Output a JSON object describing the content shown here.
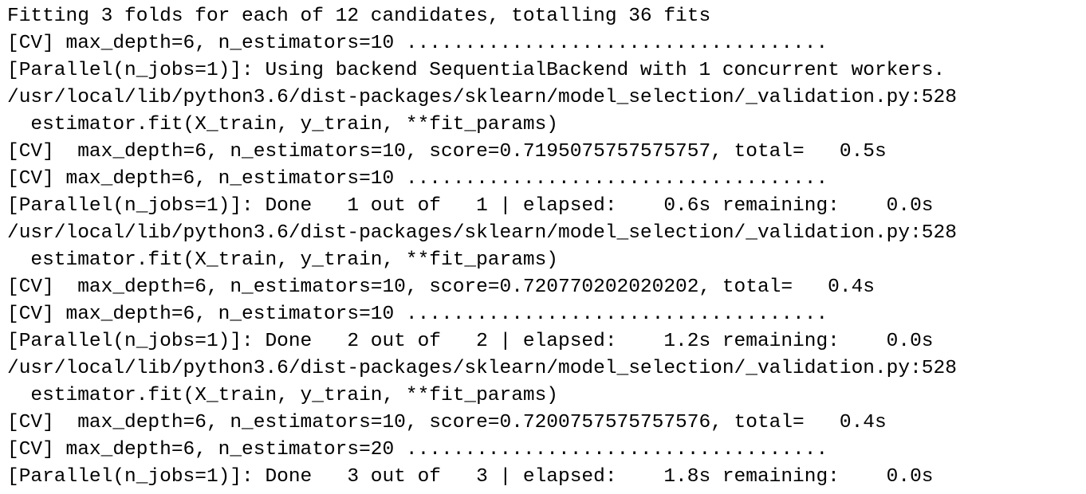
{
  "console": {
    "lines": [
      "Fitting 3 folds for each of 12 candidates, totalling 36 fits",
      "[CV] max_depth=6, n_estimators=10 ....................................",
      "[Parallel(n_jobs=1)]: Using backend SequentialBackend with 1 concurrent workers.",
      "/usr/local/lib/python3.6/dist-packages/sklearn/model_selection/_validation.py:528",
      "  estimator.fit(X_train, y_train, **fit_params)",
      "[CV]  max_depth=6, n_estimators=10, score=0.7195075757575757, total=   0.5s",
      "[CV] max_depth=6, n_estimators=10 ....................................",
      "[Parallel(n_jobs=1)]: Done   1 out of   1 | elapsed:    0.6s remaining:    0.0s",
      "/usr/local/lib/python3.6/dist-packages/sklearn/model_selection/_validation.py:528",
      "  estimator.fit(X_train, y_train, **fit_params)",
      "[CV]  max_depth=6, n_estimators=10, score=0.720770202020202, total=   0.4s",
      "[CV] max_depth=6, n_estimators=10 ....................................",
      "[Parallel(n_jobs=1)]: Done   2 out of   2 | elapsed:    1.2s remaining:    0.0s",
      "/usr/local/lib/python3.6/dist-packages/sklearn/model_selection/_validation.py:528",
      "  estimator.fit(X_train, y_train, **fit_params)",
      "[CV]  max_depth=6, n_estimators=10, score=0.7200757575757576, total=   0.4s",
      "[CV] max_depth=6, n_estimators=20 ....................................",
      "[Parallel(n_jobs=1)]: Done   3 out of   3 | elapsed:    1.8s remaining:    0.0s"
    ]
  }
}
